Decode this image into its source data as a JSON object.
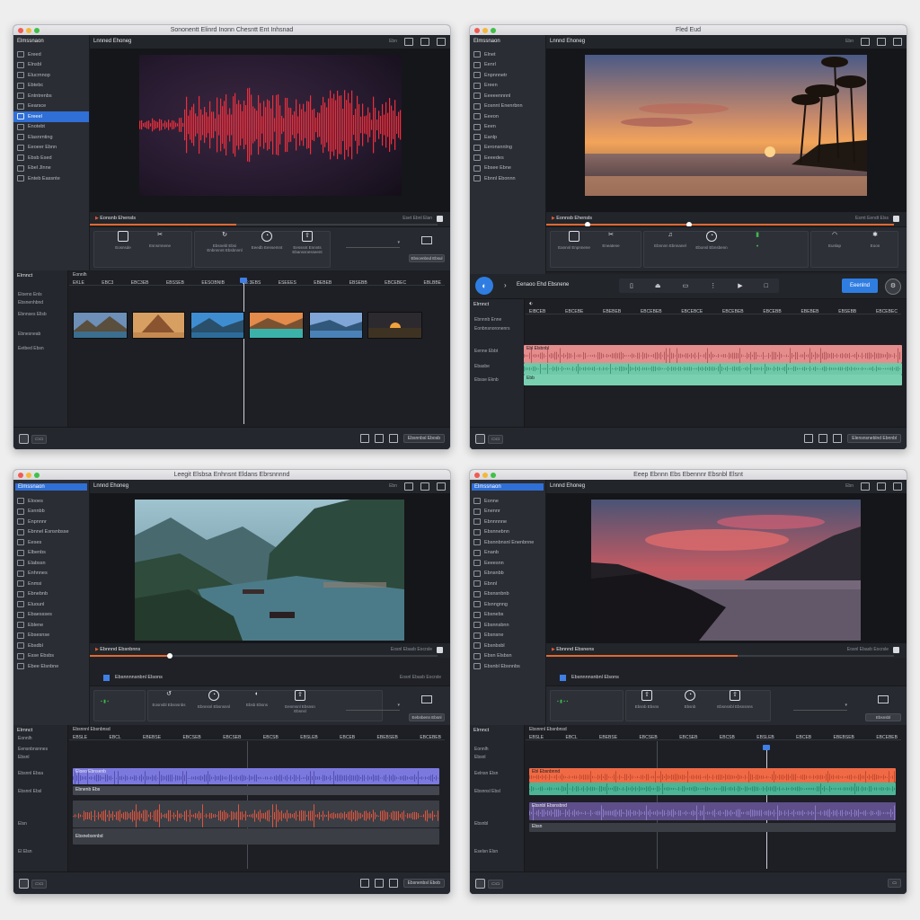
{
  "colors": {
    "accent": "#2f6fd6",
    "waveform_red": "#e8313d",
    "progress_orange": "#e2682f",
    "clip_salmon": "#e58c8c",
    "clip_teal": "#6fc9a8",
    "clip_violet": "#7c79de",
    "clip_orange": "#ef6a45"
  },
  "win1": {
    "title": "Sononentt Elinrd Inonn Chesntt Ent Inhsnad",
    "sidebar_header": "Elmssnaon",
    "sidebar": [
      "Ereed",
      "Elnsbl",
      "Elucrnnop",
      "Ebtebc",
      "Entntrenbs",
      "Eearsce",
      "Ereeel",
      "Enotebt",
      "Elasnrnting",
      "Eeoeer Ebnn",
      "Ebsb Esed",
      "Ebel Jlnne",
      "Enteb Eassnte"
    ],
    "project": "Lnnned Ehoneg",
    "top_hint": "Ebn",
    "transport_label": "Eonsnb Ehensls",
    "transport_time": "Eset Ebnl Elan",
    "tools": [
      {
        "label": "Eosnsde",
        "icon": "square-icon"
      },
      {
        "label": "Esnsrnnene",
        "icon": "cut-icon"
      },
      {
        "label": "Ebsnebl Ebsi Enbnnnnt Ebsbnnnl",
        "icon": "rotate-icon"
      },
      {
        "label": "Eeedb Eensemnt",
        "icon": "speed-icon"
      },
      {
        "label": "Eesssnt Ennnts Ebanssnesseent",
        "icon": "export-icon"
      }
    ],
    "right_button": "Ebscenbnd Ebsul",
    "track_header": "Elrnnct",
    "track_sub": "Eonnlh",
    "track_items": [
      "Eloeno Enls",
      "Ebsnenhbnd",
      "Ebnnses Ellsb",
      "Ebnesneab",
      "Eetbed Ebsn"
    ],
    "ruler_ticks": [
      "EKLE",
      "EBC3",
      "EBC3EB",
      "EBSSEB",
      "EESOBNIB",
      "EE:3EBS",
      "ESEEES",
      "EBEBEB",
      "EBSEBB",
      "EBCEBEC",
      "EBLBBE"
    ],
    "playhead_tag": "EBEBSLS",
    "bottom_right_button": "Ebsnnbsl Ebosb"
  },
  "win2": {
    "title": "Fled Eud",
    "sidebar_header": "Elmssnaon",
    "sidebar": [
      "Elnet",
      "Eenrl",
      "Enpnnnetr",
      "Ereen",
      "Eeeeennnnl",
      "Eosnnt Enenrbnn",
      "Eeeon",
      "Eeen",
      "Eanlp",
      "Eeronsnnlng",
      "Eeeedes",
      "Ebsee Ebne",
      "Ebnnl Ebonnn"
    ],
    "project": "Lnnnd Ehoneg",
    "transport_label": "Eonnsb Ehensls",
    "transport_time": "Esrnt Eendt Elss",
    "tools": [
      {
        "label": "Eannnl Enpnnene",
        "icon": "square-icon"
      },
      {
        "label": "Eneatene",
        "icon": "cut-icon"
      },
      {
        "label": "Ebnnnn Ebnnanel",
        "icon": "sound-icon"
      },
      {
        "label": "Ebonsl Ebnsbenn",
        "icon": "speed-icon"
      },
      {
        "label": "Eunlap",
        "icon": "bell-icon"
      },
      {
        "label": "Eoon",
        "icon": "gear-icon"
      }
    ],
    "playbar_label": "Eenaoo Ehd Ebsnene",
    "download_button": "Eeenlnd",
    "track_header": "Elrnnct",
    "track_sub": "Ebnnnb Enne",
    "track_sub2": "Eonbnsnoronenrs",
    "track_items": [
      "Eenne Ebbt",
      "Ebasbe",
      "Ebsse Eknb"
    ],
    "ruler_ticks": [
      "EIBCEB",
      "EBCEBE",
      "EBEBEB",
      "EBCEBEB",
      "EBCEBCE",
      "EBCEBEB",
      "EBCEBB",
      "EBEBEB",
      "EBSEBB",
      "EBCEBEC"
    ],
    "clip_labels": [
      "Ebl Elsbnbl",
      "Ebb"
    ],
    "bottom_right_button": "Elensnsneblnd Ebnnbl"
  },
  "win3": {
    "title": "Leegit Elsbsa Enhnsnt Eldans Ebrsnnnnd",
    "sidebar_header": "Elmssnaon",
    "sidebar": [
      "Elooes",
      "Esnnbb",
      "Enpnnnr",
      "Ebnnel Esnsnbsse",
      "Eeses",
      "Elbenbs",
      "Elabssn",
      "Enhnnes",
      "Enmsi",
      "Ebnebnb",
      "Eluounl",
      "Ebaessses",
      "Eblene",
      "Ebsesnse",
      "Ebsdbl",
      "Esse Ebsbs",
      "Ebee Elsnbne"
    ],
    "project": "Lnnnd Ehoneg",
    "transport_label": "Ebnnnd Ebsnbnns",
    "transport_time": "Eosnl Ebasb Eocrsle",
    "sub_label": "Ebsnnnnsnbnl Elsons",
    "tools": [
      {
        "label": "Eosnsbl Ebsnsnbs",
        "icon": "rotate-icon"
      },
      {
        "label": "Ebnnsnl Ebsnsnnl",
        "icon": "speed-icon"
      },
      {
        "label": "Ebsb Ebsns",
        "icon": "sound-icon"
      },
      {
        "label": "Eenmsnl Ebsnsn Ebsnsl",
        "icon": "export-icon"
      }
    ],
    "right_button": "Eebnbenn Ebsnl",
    "track_header": "Elrnnct",
    "track_sub": "Eonnlh",
    "track_items": [
      "Eensnbnsnnes",
      "Ebsnl",
      "Ebsnnl Ebsa",
      "Ebsnnl Ebsl",
      "Elsn",
      "El Elsn"
    ],
    "ruler_ticks": [
      "EBSLE",
      "EBCL",
      "EBEBSE",
      "EBCSEB",
      "EBCSEB",
      "EBCSB",
      "EBSLEB",
      "EBCEB",
      "EBEBSEB",
      "EBCEBEB"
    ],
    "ruler_head": "Ebsnnnl Ebsnbnsd",
    "clip_labels": [
      "Eloeo Ebnsenb",
      "Ebnenb Ebs",
      "Ebsnebsnnbd"
    ],
    "bottom_right_button": "Ebsnenbsl Ebob"
  },
  "win4": {
    "title": "Eeep Ebnnn Ebs Ebennnr Ebsnbl Elsnt",
    "sidebar_header": "Elmssnaon",
    "sidebar": [
      "Eonne",
      "Enennr",
      "Ebnnnnne",
      "Ebsnnebnn",
      "Ebsnnbnsnl Enenbnne",
      "Enanb",
      "Eeeesnn",
      "Ebnsnbb",
      "Ebnnl",
      "Ebsnsnbnb",
      "Elsnngnng",
      "Ebsnebs",
      "Ebsnnsbnn",
      "Ebsnsne",
      "Ebsnbsbl",
      "Ebsn Elsbsn",
      "Ebsnbl Ebsnnbs"
    ],
    "project": "Lnnnd Ehoneg",
    "transport_label": "Ebnnnd Ebsnens",
    "transport_time": "Eosnl Ebasb Eocrsle",
    "sub_label": "Ebsnnnnsnbnl Elsons",
    "tools": [
      {
        "label": "Ebsnb Ebsns",
        "icon": "export-icon"
      },
      {
        "label": "Ebsnb",
        "icon": "speed-icon"
      },
      {
        "label": "Ebsnsnbl Ebsnsnns",
        "icon": "export-icon"
      }
    ],
    "right_button": "Ebsnsbl",
    "track_header": "Elrnnct",
    "track_sub": "Eonnlh",
    "track_items": [
      "Ebsnl",
      "Eelnsn Elsn",
      "Ebsnnsl Ebsl",
      "Ebsnbl",
      "Eselsn Elsn"
    ],
    "ruler_ticks": [
      "EBSLE",
      "EBCL",
      "EBEBSE",
      "EBCSEB",
      "EBCSEB",
      "EBCSB",
      "EBSLEB",
      "EBCEB",
      "EBEBSEB",
      "EBCEBEB"
    ],
    "ruler_head": "Ebsnnnl Ebsnbnsd",
    "clip_labels": [
      "Ebl Ebsnbnnd",
      "Ebsnbl Ebsnsbnd",
      "Ebsn"
    ],
    "bottom_right_button": "Ebsnbnsnl"
  }
}
